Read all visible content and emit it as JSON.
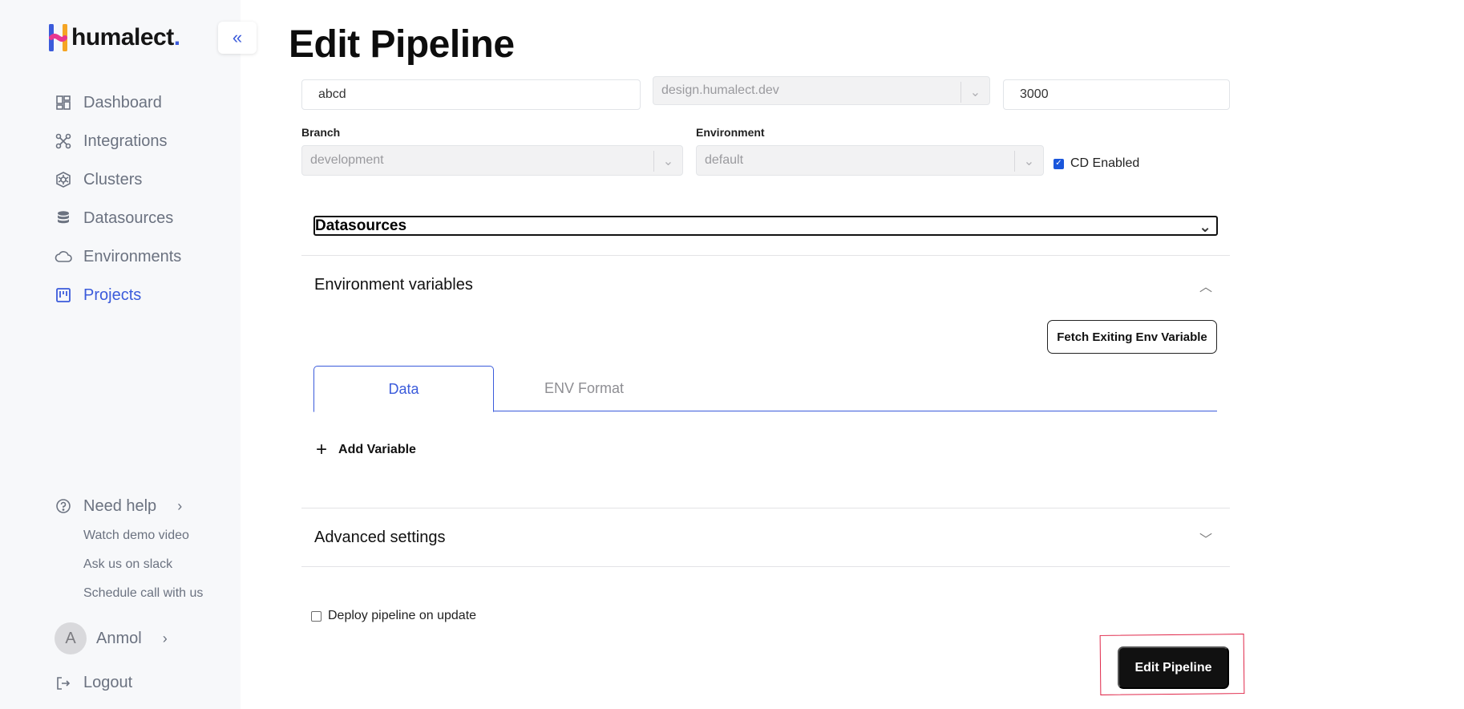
{
  "brand": {
    "name": "humalect",
    "dot": ".",
    "accent": "#3b5bdb"
  },
  "sidebar": {
    "collapse_icon": "double-chevron-left-icon",
    "items": [
      {
        "label": "Dashboard",
        "icon": "dashboard-icon",
        "active": false
      },
      {
        "label": "Integrations",
        "icon": "integrations-icon",
        "active": false
      },
      {
        "label": "Clusters",
        "icon": "clusters-icon",
        "active": false
      },
      {
        "label": "Datasources",
        "icon": "database-icon",
        "active": false
      },
      {
        "label": "Environments",
        "icon": "cloud-icon",
        "active": false
      },
      {
        "label": "Projects",
        "icon": "projects-icon",
        "active": true
      }
    ],
    "help": {
      "label": "Need help",
      "links": [
        "Watch demo video",
        "Ask us on slack",
        "Schedule call with us"
      ]
    },
    "user": {
      "initial": "A",
      "name": "Anmol"
    },
    "logout": "Logout"
  },
  "main": {
    "title": "Edit Pipeline",
    "name_value": "abcd",
    "domain_value": "design.humalect.dev",
    "port_value": "3000",
    "branch": {
      "label": "Branch",
      "value": "development"
    },
    "environment": {
      "label": "Environment",
      "value": "default"
    },
    "cd_enabled": {
      "label": "CD Enabled",
      "checked": true
    },
    "datasources": {
      "label": "Datasources"
    },
    "env_vars": {
      "title": "Environment variables",
      "fetch_button": "Fetch Exiting Env Variable",
      "tabs": [
        "Data",
        "ENV Format"
      ],
      "active_tab": "Data",
      "add_variable": "Add Variable"
    },
    "advanced": {
      "title": "Advanced settings"
    },
    "deploy_on_update": {
      "label": "Deploy pipeline on update",
      "checked": false
    },
    "submit_button": "Edit Pipeline"
  }
}
